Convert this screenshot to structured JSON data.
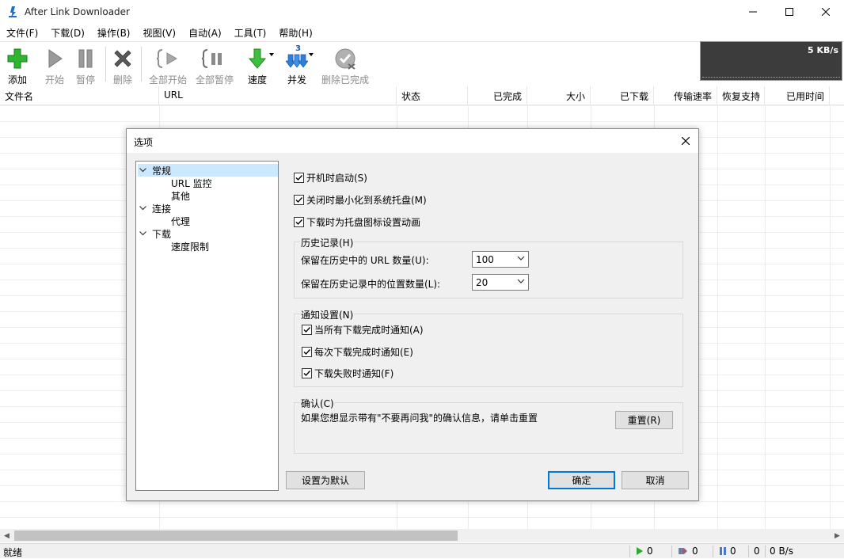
{
  "window": {
    "title": "After Link Downloader"
  },
  "menu": [
    "文件(F)",
    "下载(D)",
    "操作(B)",
    "视图(V)",
    "自动(A)",
    "工具(T)",
    "帮助(H)"
  ],
  "toolbar": {
    "add": "添加",
    "start": "开始",
    "pause": "暂停",
    "delete": "删除",
    "start_all": "全部开始",
    "pause_all": "全部暂停",
    "speed": "速度",
    "concurrent": "并发",
    "concurrent_badge": "3",
    "delete_completed": "删除已完成"
  },
  "speed_graph": {
    "value": "5 KB/s"
  },
  "columns": [
    "文件名",
    "URL",
    "状态",
    "已完成",
    "大小",
    "已下载",
    "传输速率",
    "恢复支持",
    "已用时间"
  ],
  "status": {
    "ready": "就绪",
    "running": "0",
    "queued": "0",
    "paused": "0",
    "completed": "0",
    "speed": "0 B/s"
  },
  "dialog": {
    "title": "选项",
    "tree": [
      {
        "label": "常规",
        "level": 0,
        "expanded": true,
        "selected": true
      },
      {
        "label": "URL 监控",
        "level": 1
      },
      {
        "label": "其他",
        "level": 1
      },
      {
        "label": "连接",
        "level": 0,
        "expanded": true
      },
      {
        "label": "代理",
        "level": 1
      },
      {
        "label": "下载",
        "level": 0,
        "expanded": true
      },
      {
        "label": "速度限制",
        "level": 1
      }
    ],
    "options": {
      "start_on_boot": {
        "label": "开机时启动(S)",
        "checked": true
      },
      "minimize_to_tray": {
        "label": "关闭时最小化到系统托盘(M)",
        "checked": true
      },
      "tray_animation": {
        "label": "下载时为托盘图标设置动画",
        "checked": true
      }
    },
    "history": {
      "title": "历史记录(H)",
      "url_count_label": "保留在历史中的 URL 数量(U):",
      "url_count_value": "100",
      "location_count_label": "保留在历史记录中的位置数量(L):",
      "location_count_value": "20"
    },
    "notify": {
      "title": "通知设置(N)",
      "all_done": {
        "label": "当所有下载完成时通知(A)",
        "checked": true
      },
      "each_done": {
        "label": "每次下载完成时通知(E)",
        "checked": true
      },
      "failed": {
        "label": "下载失败时通知(F)",
        "checked": true
      }
    },
    "confirm": {
      "title": "确认(C)",
      "text": "如果您想显示带有\"不要再问我\"的确认信息，请单击重置",
      "reset": "重置(R)"
    },
    "buttons": {
      "set_default": "设置为默认",
      "ok": "确定",
      "cancel": "取消"
    }
  }
}
